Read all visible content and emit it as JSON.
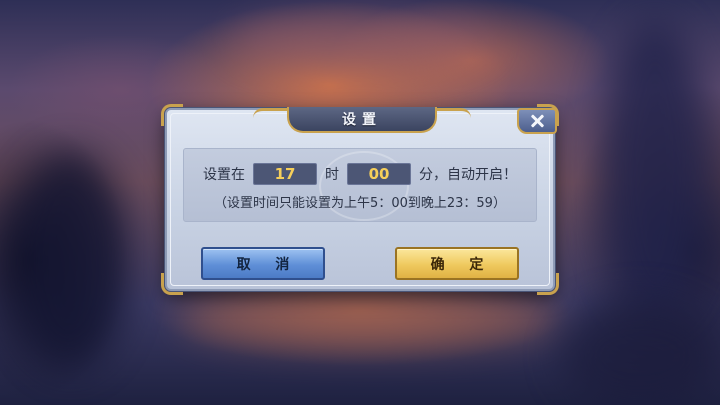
{
  "dialog": {
    "title": "设置",
    "prefix": "设置在",
    "hour": "17",
    "hour_unit": "时",
    "minute": "00",
    "suffix": "分，自动开启！",
    "note": "（设置时间只能设置为上午5：00到晚上23：59）",
    "cancel_label": "取 消",
    "confirm_label": "确 定",
    "close_icon": "close-icon"
  },
  "colors": {
    "time_value": "#f6cf5a",
    "frame_gold": "#c9a24e",
    "cancel_button": "#5f8fd7",
    "confirm_button": "#efc95e"
  }
}
